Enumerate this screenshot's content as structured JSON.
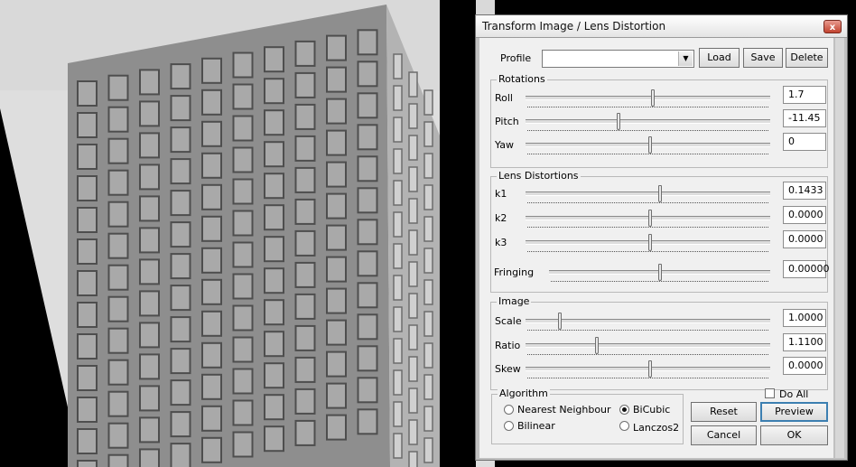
{
  "dialog": {
    "title": "Transform Image / Lens Distortion",
    "close_glyph": "x",
    "profile": {
      "label": "Profile",
      "value": "",
      "arrow_glyph": "▼"
    },
    "buttons": {
      "load": "Load",
      "save": "Save",
      "delete": "Delete",
      "reset": "Reset",
      "preview": "Preview",
      "cancel": "Cancel",
      "ok": "OK"
    },
    "rotations": {
      "title": "Rotations",
      "roll": {
        "label": "Roll",
        "value": "1.7",
        "level": 0.52
      },
      "pitch": {
        "label": "Pitch",
        "value": "-11.45",
        "level": 0.38
      },
      "yaw": {
        "label": "Yaw",
        "value": "0",
        "level": 0.51
      }
    },
    "lens": {
      "title": "Lens Distortions",
      "k1": {
        "label": "k1",
        "value": "0.1433",
        "level": 0.55
      },
      "k2": {
        "label": "k2",
        "value": "0.0000",
        "level": 0.51
      },
      "k3": {
        "label": "k3",
        "value": "0.0000",
        "level": 0.51
      },
      "fringing": {
        "label": "Fringing",
        "value": "0.00000",
        "level": 0.5
      }
    },
    "image": {
      "title": "Image",
      "scale": {
        "label": "Scale",
        "value": "1.0000",
        "level": 0.14
      },
      "ratio": {
        "label": "Ratio",
        "value": "1.1100",
        "level": 0.29
      },
      "skew": {
        "label": "Skew",
        "value": "0.0000",
        "level": 0.51
      }
    },
    "algorithm": {
      "title": "Algorithm",
      "options": [
        "Nearest Neighbour",
        "BiCubic",
        "Bilinear",
        "Lanczos2"
      ],
      "selected": "BiCubic"
    },
    "do_all": {
      "label": "Do All",
      "checked": false
    }
  }
}
